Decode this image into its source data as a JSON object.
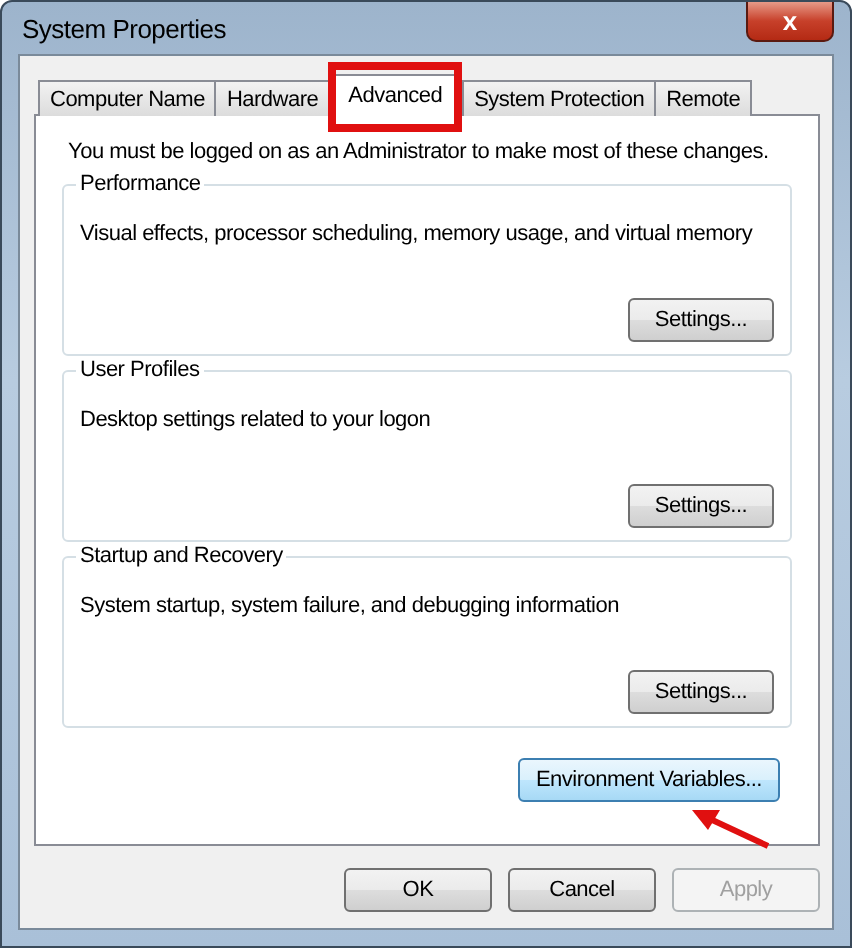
{
  "window": {
    "title": "System Properties",
    "close": "x"
  },
  "tabs": [
    {
      "label": "Computer Name",
      "selected": false
    },
    {
      "label": "Hardware",
      "selected": false
    },
    {
      "label": "Advanced",
      "selected": true
    },
    {
      "label": "System Protection",
      "selected": false
    },
    {
      "label": "Remote",
      "selected": false
    }
  ],
  "notice": "You must be logged on as an Administrator to make most of these changes.",
  "groups": [
    {
      "title": "Performance",
      "description": "Visual effects, processor scheduling, memory usage, and virtual memory",
      "button": "Settings..."
    },
    {
      "title": "User Profiles",
      "description": "Desktop settings related to your logon",
      "button": "Settings..."
    },
    {
      "title": "Startup and Recovery",
      "description": "System startup, system failure, and debugging information",
      "button": "Settings..."
    }
  ],
  "environment_button": "Environment Variables...",
  "buttons": [
    {
      "label": "OK",
      "disabled": false
    },
    {
      "label": "Cancel",
      "disabled": false
    },
    {
      "label": "Apply",
      "disabled": true
    }
  ]
}
